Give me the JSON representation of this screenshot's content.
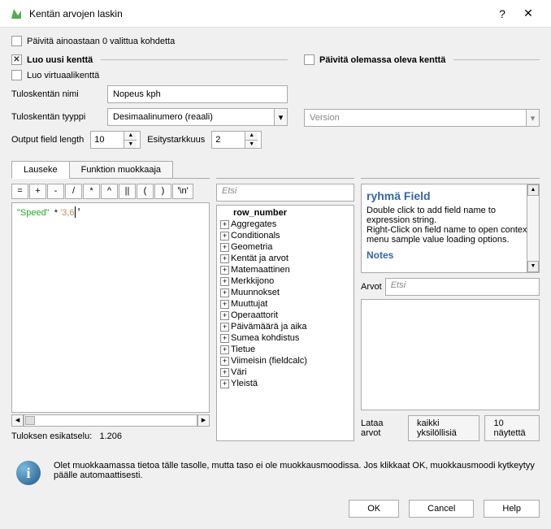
{
  "title": "Kentän arvojen laskin",
  "update_selected_label": "Päivitä ainoastaan 0 valittua kohdetta",
  "create_field_group": "Luo uusi kenttä",
  "update_field_group": "Päivitä olemassa oleva kenttä",
  "create_virtual_label": "Luo virtuaalikenttä",
  "output_name_label": "Tuloskentän nimi",
  "output_name_value": "Nopeus kph",
  "output_type_label": "Tuloskentän tyyppi",
  "output_type_value": "Desimaalinumero (reaali)",
  "output_length_label": "Output field length",
  "output_length_value": "10",
  "precision_label": "Esitystarkkuus",
  "precision_value": "2",
  "version_label": "Version",
  "tabs": {
    "expression": "Lauseke",
    "editor": "Funktion muokkaaja"
  },
  "operators": [
    "=",
    "+",
    "-",
    "/",
    "*",
    "^",
    "||",
    "(",
    ")",
    "'\\n'"
  ],
  "expression_tokens": [
    {
      "text": "\"Speed\"",
      "cls": "tok-field"
    },
    {
      "text": "  * ",
      "cls": ""
    },
    {
      "text": "'3,6",
      "cls": "tok-str"
    }
  ],
  "preview_label": "Tuloksen esikatselu:",
  "preview_value": "1.206",
  "tree_search_placeholder": "Etsi",
  "tree": {
    "row_number": "row_number",
    "groups": [
      "Aggregates",
      "Conditionals",
      "Geometria",
      "Kentät ja arvot",
      "Matemaattinen",
      "Merkkijono",
      "Muunnokset",
      "Muuttujat",
      "Operaattorit",
      "Päivämäärä ja aika",
      "Sumea kohdistus",
      "Tietue",
      "Viimeisin (fieldcalc)",
      "Väri",
      "Yleistä"
    ]
  },
  "help": {
    "title": "ryhmä Field",
    "body1": "Double click to add field name to expression string.",
    "body2": "Right-Click on field name to open context menu sample value loading options.",
    "notes": "Notes"
  },
  "arvot_label": "Arvot",
  "arvot_placeholder": "Etsi",
  "load_values": "Lataa arvot",
  "all_unique": "kaikki yksilöllisiä",
  "ten_samples": "10 näytettä",
  "info_text": "Olet muokkaamassa tietoa tälle tasolle, mutta taso ei ole muokkausmoodissa. Jos klikkaat OK, muokkausmoodi kytkeytyy päälle automaattisesti.",
  "buttons": {
    "ok": "OK",
    "cancel": "Cancel",
    "help": "Help"
  }
}
